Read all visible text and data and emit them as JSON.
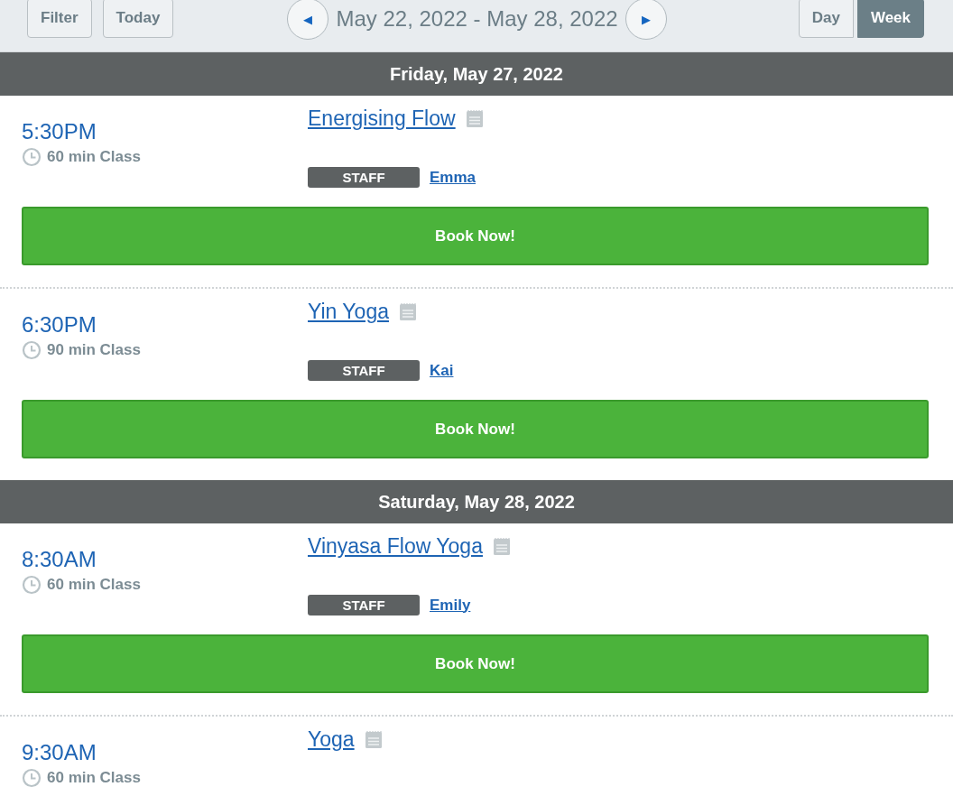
{
  "toolbar": {
    "left_buttons": [
      "Filter",
      "Today"
    ],
    "prev": "◀",
    "range": "May 22, 2022 - May 28, 2022",
    "next": "▶",
    "views": [
      {
        "label": "Day",
        "selected": false
      },
      {
        "label": "Week",
        "selected": true
      }
    ]
  },
  "days": [
    {
      "heading": "Friday, May 27, 2022",
      "classes": [
        {
          "time": "5:30PM",
          "duration": "60 min Class",
          "title": "Energising Flow",
          "staff_label": "STAFF",
          "staff": "Emma",
          "button": "Book Now!"
        },
        {
          "time": "6:30PM",
          "duration": "90 min Class",
          "title": "Yin Yoga",
          "staff_label": "STAFF",
          "staff": "Kai",
          "button": "Book Now!"
        }
      ]
    },
    {
      "heading": "Saturday, May 28, 2022",
      "classes": [
        {
          "time": "8:30AM",
          "duration": "60 min Class",
          "title": "Vinyasa Flow Yoga",
          "staff_label": "STAFF",
          "staff": "Emily",
          "button": "Book Now!"
        },
        {
          "time": "9:30AM",
          "duration": "60 min Class",
          "title": "Yoga"
        }
      ]
    }
  ]
}
